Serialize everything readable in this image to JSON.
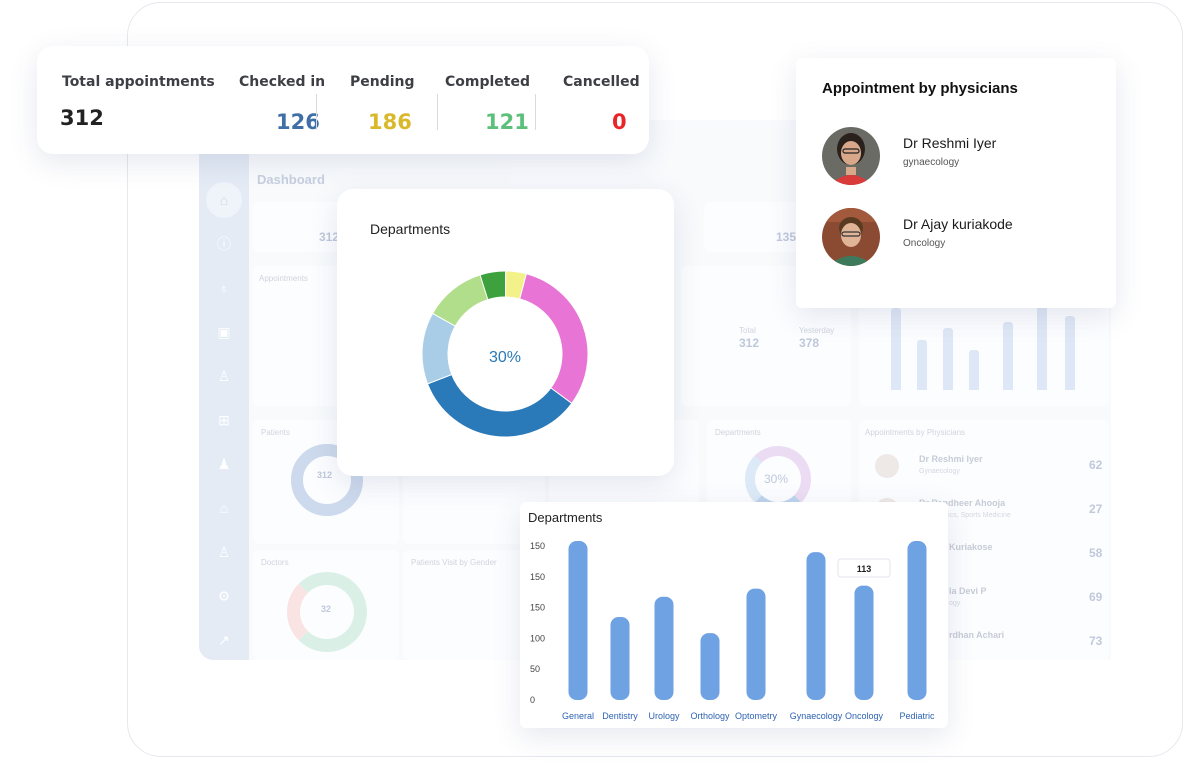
{
  "stats": {
    "total": {
      "label": "Total appointments",
      "value": "312"
    },
    "items": [
      {
        "label": "Checked in",
        "value": "126",
        "color": "#3f6fa6"
      },
      {
        "label": "Pending",
        "value": "186",
        "color": "#d9b92a"
      },
      {
        "label": "Completed",
        "value": "121",
        "color": "#5cc07a"
      },
      {
        "label": "Cancelled",
        "value": "0",
        "color": "#e8262a"
      }
    ]
  },
  "physicians": {
    "title": "Appointment by physicians",
    "doctors": [
      {
        "name": "Dr Reshmi Iyer",
        "specialty": "gynaecology"
      },
      {
        "name": "Dr Ajay kuriakode",
        "specialty": "Oncology"
      }
    ]
  },
  "departments_donut": {
    "title": "Departments",
    "center_text": "30%"
  },
  "background_dashboard": {
    "title": "Dashboard",
    "appointments_label": "Appointments",
    "patients_label": "Patients",
    "doctors_label": "Doctors",
    "patients_visit_label": "Patients Visit by Gender",
    "departments_label": "Departments",
    "departments_center": "30%",
    "appointments_by_physicians_label": "Appointments by Physicians",
    "stat_a": "312",
    "stat_b": "135",
    "total_label": "Total",
    "total_value": "312",
    "yesterday_label": "Yesterday",
    "yesterday_value": "378",
    "patients_ring_value": "312",
    "doctors_ring_value": "32",
    "rows": [
      {
        "name": "Dr Reshmi Iyer",
        "sub": "Gynaecology",
        "value": "62"
      },
      {
        "name": "Dr Pandheer Ahooja",
        "sub": "Orthopedics, Sports Medicine",
        "value": "27"
      },
      {
        "name": "Kuriakose",
        "sub": "",
        "value": "58"
      },
      {
        "name": "la Devi P",
        "sub": "ogy",
        "value": "69"
      },
      {
        "name": "rdhan Achari",
        "sub": "",
        "value": "73"
      }
    ]
  },
  "chart_data": {
    "type": "bar",
    "title": "Departments",
    "categories": [
      "General",
      "Dentistry",
      "Urology",
      "Orthology",
      "Optometry",
      "Gynaecology",
      "Oncology",
      "Pediatric"
    ],
    "values": [
      157,
      82,
      102,
      66,
      110,
      146,
      113,
      157
    ],
    "ytick_labels": [
      "0",
      "50",
      "100",
      "150",
      "150",
      "150"
    ],
    "ylim": [
      0,
      160
    ],
    "tooltip": {
      "category": "Oncology",
      "value": "113"
    },
    "bar_color": "#6fa2e2",
    "label_color": "#2f63b3"
  },
  "donut_chart": {
    "type": "pie",
    "slices": [
      {
        "value": 31,
        "color": "#e874d5"
      },
      {
        "value": 34,
        "color": "#2a79b8"
      },
      {
        "value": 14,
        "color": "#a9cde6"
      },
      {
        "value": 12,
        "color": "#b1de8a"
      },
      {
        "value": 5,
        "color": "#3da23d"
      },
      {
        "value": 4,
        "color": "#f3f28a"
      }
    ],
    "center_color": "#2a79b8"
  }
}
